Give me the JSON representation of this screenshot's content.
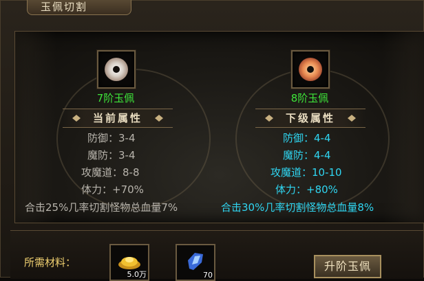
{
  "window": {
    "title": "玉佩切割"
  },
  "current": {
    "item_name": "7阶玉佩",
    "section_title": "当前属性",
    "stats": [
      "防御：3-4",
      "魔防：3-4",
      "攻魔道：8-8",
      "体力：+70%"
    ],
    "bonus": "合击25%几率切割怪物总血量7%"
  },
  "next": {
    "item_name": "8阶玉佩",
    "section_title": "下级属性",
    "stats": [
      "防御：4-4",
      "魔防：4-4",
      "攻魔道：10-10",
      "体力：+80%"
    ],
    "bonus": "合击30%几率切割怪物总血量8%"
  },
  "materials": {
    "label": "所需材料：",
    "items": [
      {
        "icon": "gold-ingot-icon",
        "count": "5.0万"
      },
      {
        "icon": "crystal-shard-icon",
        "count": "70"
      }
    ]
  },
  "actions": {
    "upgrade_label": "升阶玉佩"
  },
  "colors": {
    "tier_name": "#3ee63a",
    "next_stats": "#2fd6f2",
    "current_stats": "#b8b4ac",
    "material_label": "#f0d070"
  }
}
